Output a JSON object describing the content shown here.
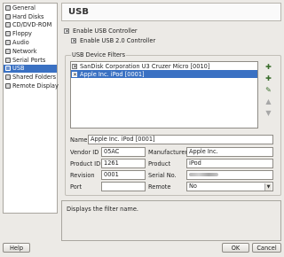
{
  "sidebar": {
    "items": [
      {
        "label": "General",
        "icon": "general-icon"
      },
      {
        "label": "Hard Disks",
        "icon": "hard-disk-icon"
      },
      {
        "label": "CD/DVD-ROM",
        "icon": "cdrom-icon"
      },
      {
        "label": "Floppy",
        "icon": "floppy-icon"
      },
      {
        "label": "Audio",
        "icon": "audio-icon"
      },
      {
        "label": "Network",
        "icon": "network-icon"
      },
      {
        "label": "Serial Ports",
        "icon": "serial-port-icon"
      },
      {
        "label": "USB",
        "icon": "usb-icon",
        "selected": true
      },
      {
        "label": "Shared Folders",
        "icon": "shared-folder-icon"
      },
      {
        "label": "Remote Display",
        "icon": "remote-display-icon"
      }
    ]
  },
  "header": {
    "title": "USB"
  },
  "usb": {
    "enable_controller": {
      "label": "Enable USB Controller",
      "checked": true
    },
    "enable_usb2": {
      "label": "Enable USB 2.0 Controller",
      "checked": true
    }
  },
  "filters": {
    "title": "USB Device Filters",
    "items": [
      {
        "label": "SanDisk Corporation U3 Cruzer Micro [0010]",
        "checked": true,
        "selected": false
      },
      {
        "label": "Apple Inc. iPod [0001]",
        "checked": true,
        "selected": true
      }
    ],
    "toolbar": [
      "add-filter-icon",
      "add-from-device-icon",
      "edit-filter-icon",
      "move-up-icon",
      "move-down-icon"
    ]
  },
  "form": {
    "name_label": "Name",
    "name_value": "Apple Inc. iPod [0001]",
    "vendor_id_label": "Vendor ID",
    "vendor_id_value": "05AC",
    "manufacturer_label": "Manufacturer",
    "manufacturer_value": "Apple Inc.",
    "product_id_label": "Product ID",
    "product_id_value": "1261",
    "product_label": "Product",
    "product_value": "iPod",
    "revision_label": "Revision",
    "revision_value": "0001",
    "serial_label": "Serial No.",
    "port_label": "Port",
    "port_value": "",
    "remote_label": "Remote",
    "remote_value": "No"
  },
  "info": {
    "text": "Displays the filter name."
  },
  "buttons": {
    "help": "Help",
    "ok": "OK",
    "cancel": "Cancel"
  },
  "colors": {
    "selection": "#3a71c3",
    "background": "#eceae6"
  }
}
